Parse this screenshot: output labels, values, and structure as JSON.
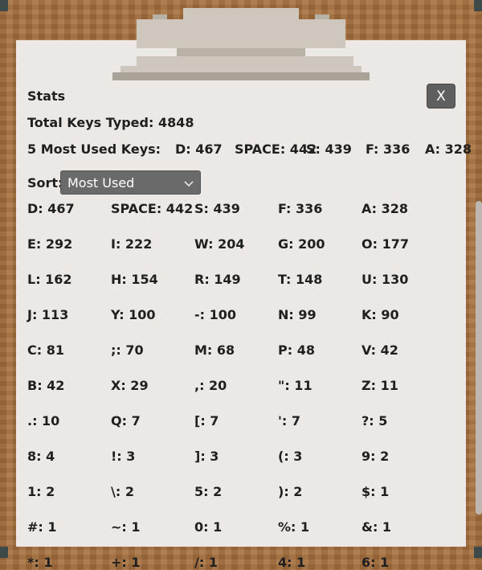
{
  "window": {
    "title": "Stats",
    "close_label": "X"
  },
  "summary": {
    "total_keys": "Total Keys Typed: 4848",
    "top5_label": "5 Most Used Keys:",
    "top5": [
      "D: 467",
      "SPACE: 442",
      "S: 439",
      "F: 336",
      "A: 328"
    ]
  },
  "sort": {
    "label": "Sort:",
    "selected": "Most Used"
  },
  "keys": [
    "D: 467",
    "SPACE: 442",
    "S: 439",
    "F: 336",
    "A: 328",
    "E: 292",
    "I: 222",
    "W: 204",
    "G: 200",
    "O: 177",
    "L: 162",
    "H: 154",
    "R: 149",
    "T: 148",
    "U: 130",
    "J: 113",
    "Y: 100",
    "-: 100",
    "N: 99",
    "K: 90",
    "C: 81",
    ";: 70",
    "M: 68",
    "P: 48",
    "V: 42",
    "B: 42",
    "X: 29",
    ",: 20",
    "\": 11",
    "Z: 11",
    ".: 10",
    "Q: 7",
    "[: 7",
    "': 7",
    "?: 5",
    "8: 4",
    "!: 3",
    "]: 3",
    "(: 3",
    "9: 2",
    "1: 2",
    "\\: 2",
    "5: 2",
    "): 2",
    "$: 1",
    "#: 1",
    "~: 1",
    "0: 1",
    "%: 1",
    "&: 1",
    "*: 1",
    "+: 1",
    "/: 1",
    "4: 1",
    "6: 1"
  ],
  "colors": {
    "wood": "#a8713f",
    "paper": "#ebe8e5",
    "button": "#5f5f5f",
    "text": "#1f1f1f"
  }
}
